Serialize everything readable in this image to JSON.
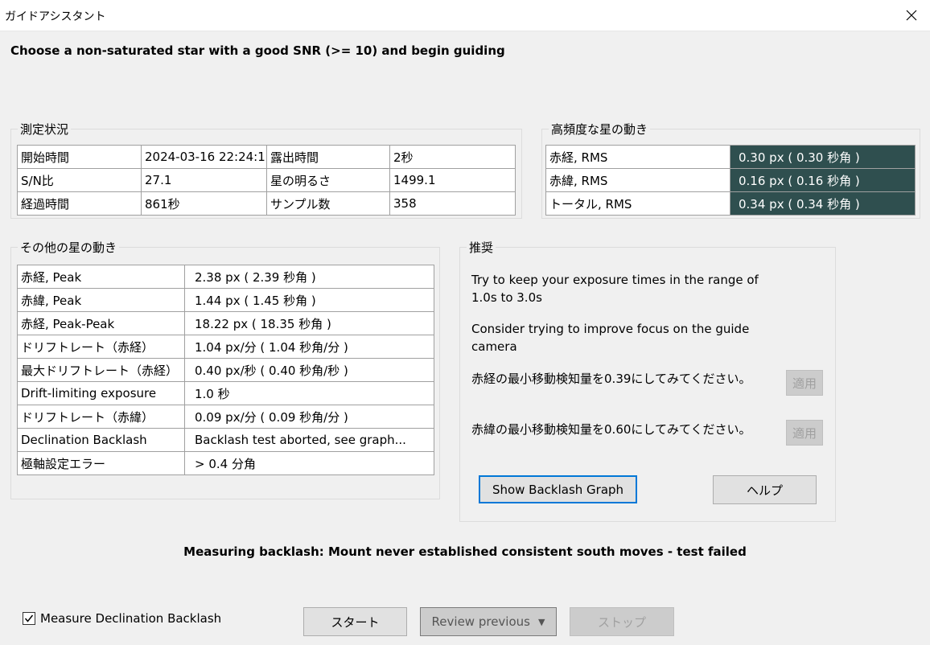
{
  "window": {
    "title": "ガイドアシスタント"
  },
  "instruction": "Choose a non-saturated star with a good SNR (>= 10) and begin guiding",
  "measurement": {
    "legend": "測定状況",
    "rows": [
      [
        "開始時間",
        "2024-03-16 22:24:1:",
        "露出時間",
        "2秒"
      ],
      [
        "S/N比",
        "27.1",
        "星の明るさ",
        "1499.1"
      ],
      [
        "経過時間",
        "861秒",
        "サンプル数",
        "358"
      ]
    ]
  },
  "high_freq": {
    "legend": "高頻度な星の動き",
    "rows": [
      [
        "赤経, RMS",
        "0.30 px ( 0.30 秒角 )"
      ],
      [
        "赤緯, RMS",
        "0.16 px ( 0.16 秒角 )"
      ],
      [
        "トータル, RMS",
        "0.34 px ( 0.34 秒角 )"
      ]
    ]
  },
  "other_motion": {
    "legend": "その他の星の動き",
    "rows": [
      [
        "赤経, Peak",
        "2.38 px ( 2.39 秒角 )"
      ],
      [
        "赤緯, Peak",
        "1.44 px ( 1.45 秒角 )"
      ],
      [
        "赤経, Peak-Peak",
        "18.22 px ( 18.35 秒角 )"
      ],
      [
        "ドリフトレート（赤経）",
        "1.04 px/分 ( 1.04 秒角/分 )"
      ],
      [
        "最大ドリフトレート（赤経）",
        "0.40 px/秒 ( 0.40 秒角/秒 )"
      ],
      [
        "Drift-limiting exposure",
        "1.0 秒"
      ],
      [
        "ドリフトレート（赤緯）",
        "0.09 px/分 ( 0.09 秒角/分 )"
      ],
      [
        "Declination Backlash",
        "Backlash test aborted, see graph..."
      ],
      [
        "極軸設定エラー",
        "> 0.4 分角"
      ]
    ]
  },
  "recommendation": {
    "legend": "推奨",
    "exposure_text": "Try to keep your exposure times in the range of 1.0s to 3.0s",
    "focus_text": "Consider trying to improve focus on the guide camera",
    "ra_min_move_text": "赤経の最小移動検知量を0.39にしてみてください。",
    "dec_min_move_text": "赤緯の最小移動検知量を0.60にしてみてください。",
    "apply_label": "適用",
    "backlash_graph_label": "Show Backlash Graph",
    "help_label": "ヘルプ"
  },
  "status": "Measuring backlash: Mount never established consistent south moves - test failed",
  "footer": {
    "measure_dec_backlash_label": "Measure Declination Backlash",
    "measure_dec_backlash_checked": true,
    "start_label": "スタート",
    "review_label": "Review previous",
    "stop_label": "ストップ"
  },
  "colors": {
    "rms_bg": "#2f4f4f",
    "focus_border": "#0078d7"
  },
  "icons": {
    "close": "close-icon",
    "dropdown": "chevron-down-icon",
    "check": "check-icon"
  }
}
